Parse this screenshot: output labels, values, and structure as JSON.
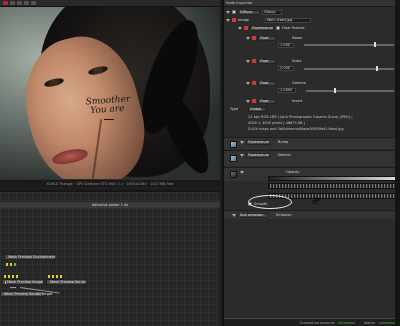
{
  "viewport": {
    "annotation": [
      "Smoother",
      "You are"
    ],
    "status_text": "XOXCS Triangle · GPU GeForce GTX 560 ( 1 ) · 1920x1080 · 1023 MB free"
  },
  "graph": {
    "header": "Adhesive power 1 ok",
    "nodes": [
      {
        "label": "Mesh Preview Environment"
      },
      {
        "label": "Mesh Preview Image"
      },
      {
        "label": "Mesh Preview Kernel"
      },
      {
        "label": "Mesh Preview RenderTarget"
      }
    ]
  },
  "inspector": {
    "title": "Node Inspector",
    "header_dropdown": "Diffuse",
    "header_value": "Glossy",
    "rows": {
      "image": {
        "label": "Image",
        "value": "Wet1-fixed.jpg"
      },
      "texture_a": {
        "dropdown": "Floattexture",
        "label": "Float Texture"
      },
      "float_a": {
        "label": "Float",
        "name": "Power",
        "value": "1.000"
      },
      "float_b": {
        "label": "Float",
        "name": "Scale",
        "value": "2.000"
      },
      "float_c": {
        "label": "Float",
        "name": "Gamma",
        "value": "1.0000"
      },
      "float_d": {
        "label": "Float",
        "name": "Invert",
        "value": "1.0000"
      },
      "type": {
        "label": "Type",
        "value": "Global"
      }
    },
    "info_lines": [
      "24 bpc RGB LDR | Joint Photographic Experts Group (JPEG) |",
      "4000 × 4000 pixels | 46875 KB |",
      "D:/UV maps and 3d/Adrianne/Maps/WIP/Wet1-fixed.jpg"
    ],
    "sections": [
      {
        "dropdown": "Floattexture",
        "label": "Bump"
      },
      {
        "dropdown": "Floattexture",
        "label": "Normal"
      },
      {
        "label": "Opacity"
      }
    ],
    "smooth_label": "Smooth",
    "emission_dropdown": "Null emission",
    "emission_label": "Emission"
  },
  "footer": {
    "account_label": "OctaneLive account:",
    "account_status": "activated",
    "status_label": "status:",
    "status_value": "connected"
  },
  "colors": {
    "accent_ok": "#4fc14f",
    "pin_red": "#cc3a3a",
    "pin_yellow": "#d8d030"
  }
}
